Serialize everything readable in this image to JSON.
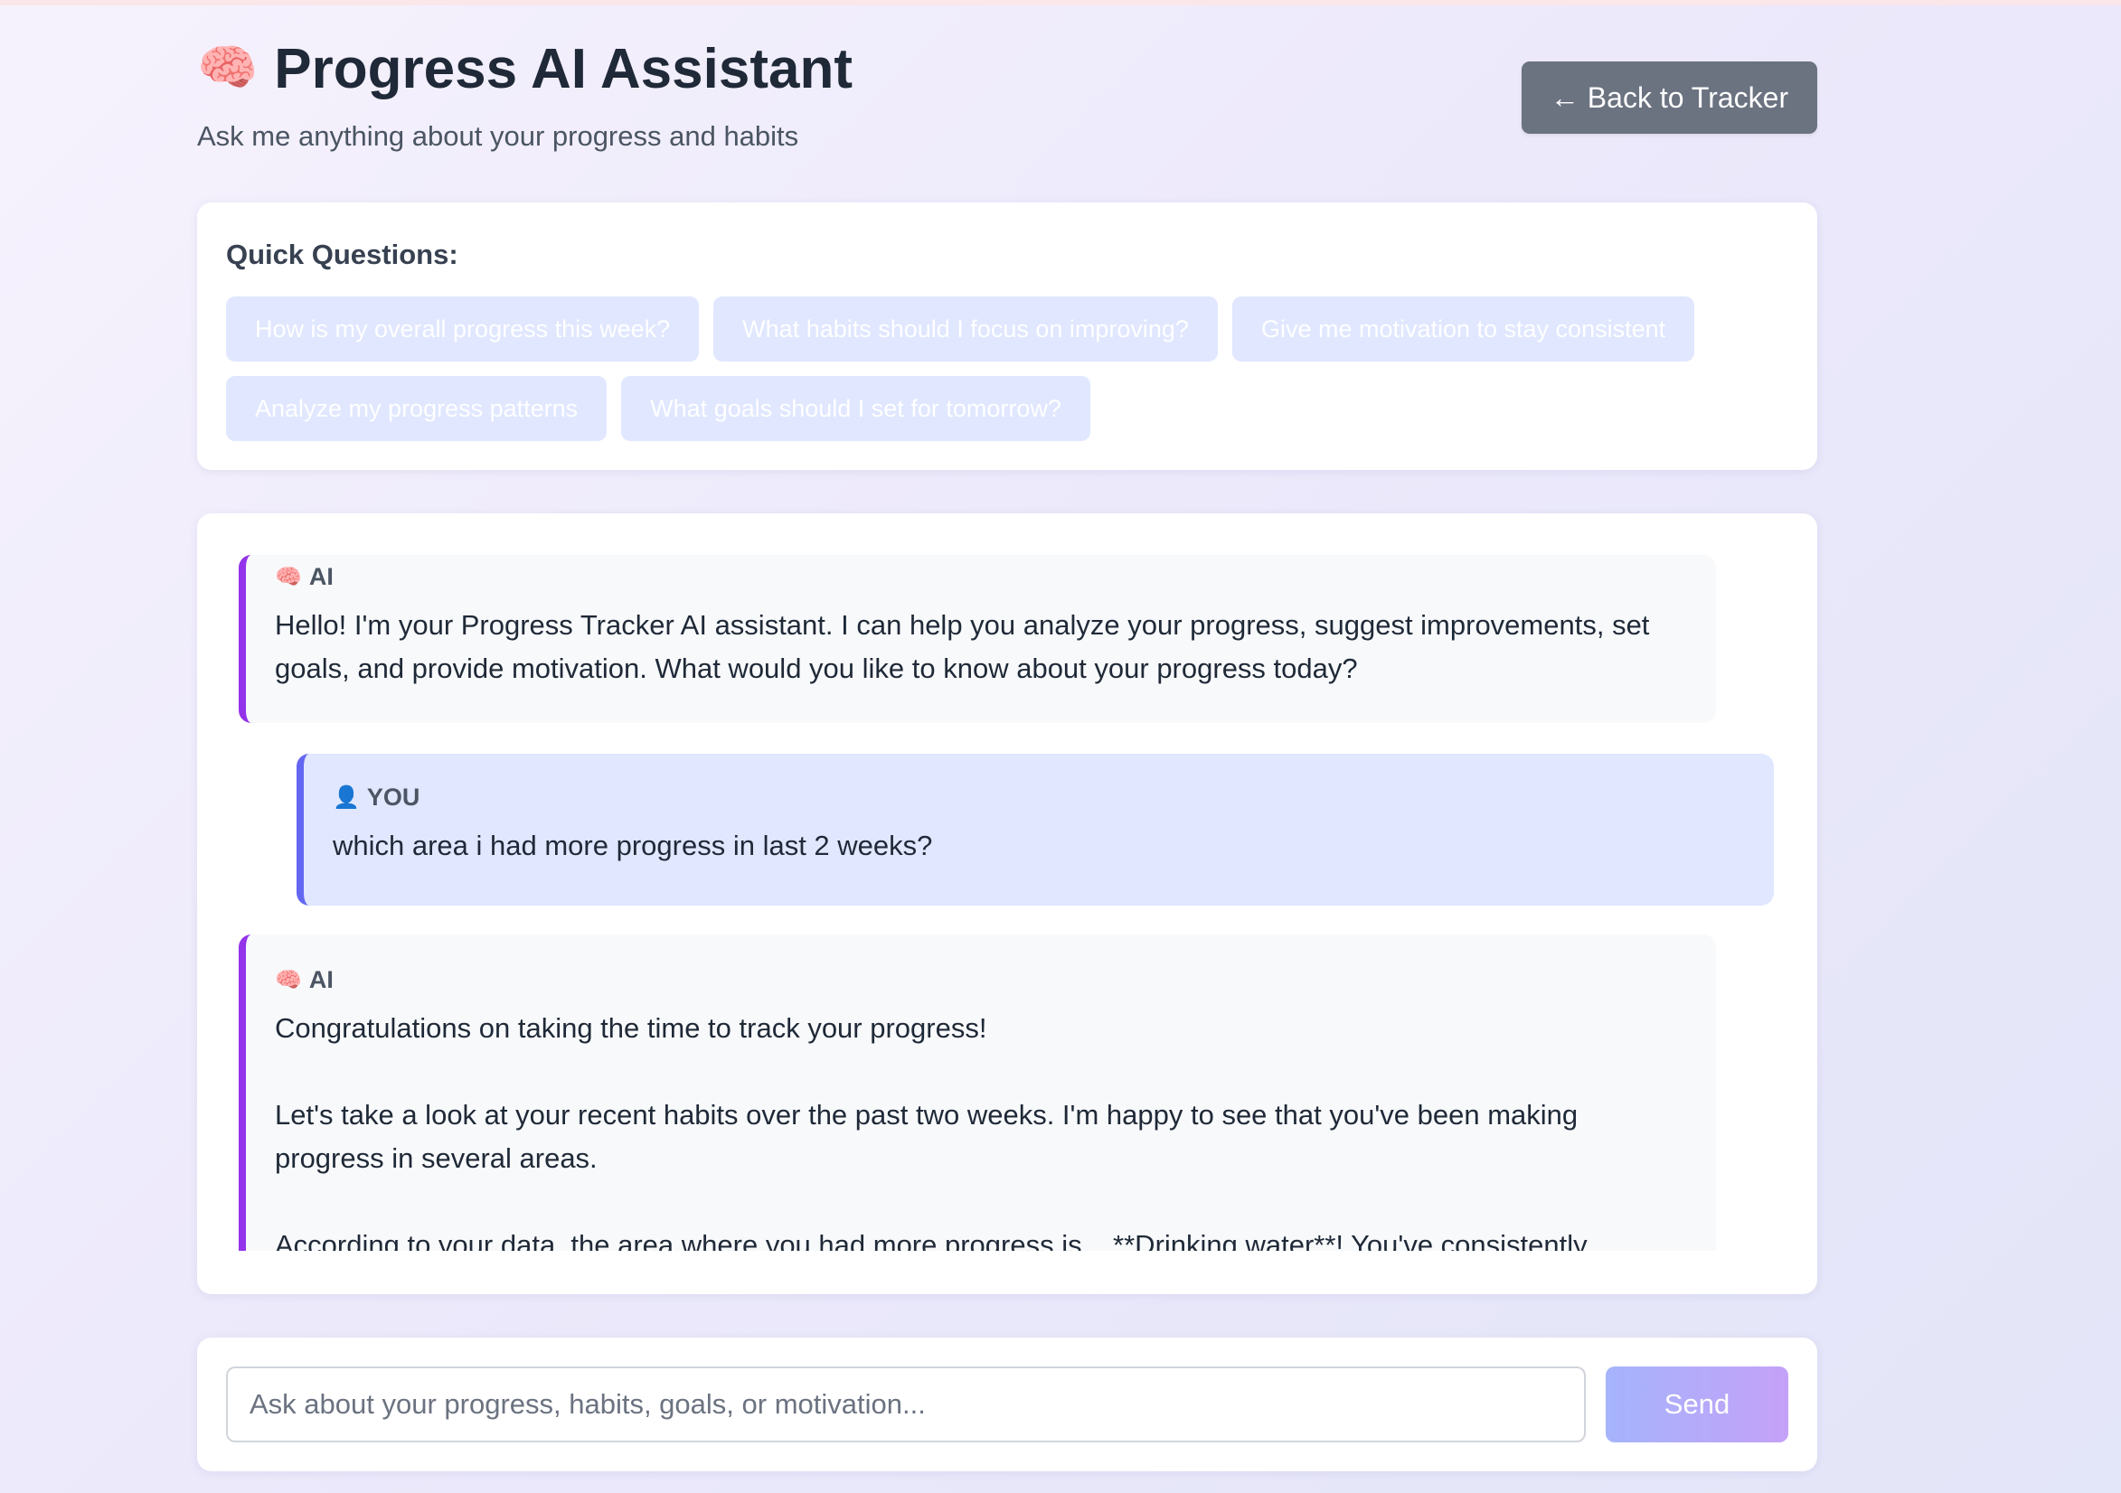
{
  "header": {
    "brain_emoji": "🧠",
    "title": "Progress AI Assistant",
    "subtitle": "Ask me anything about your progress and habits",
    "back_button": "← Back to Tracker"
  },
  "quick_questions": {
    "title": "Quick Questions:",
    "items": [
      "How is my overall progress this week?",
      "What habits should I focus on improving?",
      "Give me motivation to stay consistent",
      "Analyze my progress patterns",
      "What goals should I set for tomorrow?"
    ]
  },
  "chat": {
    "messages": [
      {
        "sender_icon": "🧠",
        "sender": "AI",
        "paragraphs": [
          "Hello! I'm your Progress Tracker AI assistant. I can help you analyze your progress, suggest improvements, set goals, and provide motivation. What would you like to know about your progress today?"
        ]
      },
      {
        "sender_icon": "👤",
        "sender": "YOU",
        "paragraphs": [
          "which area i had more progress in last 2 weeks?"
        ]
      },
      {
        "sender_icon": "🧠",
        "sender": "AI",
        "paragraphs": [
          "Congratulations on taking the time to track your progress!",
          "Let's take a look at your recent habits over the past two weeks. I'm happy to see that you've been making progress in several areas.",
          "According to your data, the area where you had more progress is... **Drinking water**! You've consistently"
        ]
      }
    ]
  },
  "input": {
    "placeholder": "Ask about your progress, habits, goals, or motivation...",
    "value": "",
    "send_label": "Send"
  },
  "colors": {
    "ai_accent": "#9333ea",
    "user_accent": "#6366f1",
    "back_button_bg": "#6b7280",
    "chip_bg": "#e0e7ff"
  }
}
